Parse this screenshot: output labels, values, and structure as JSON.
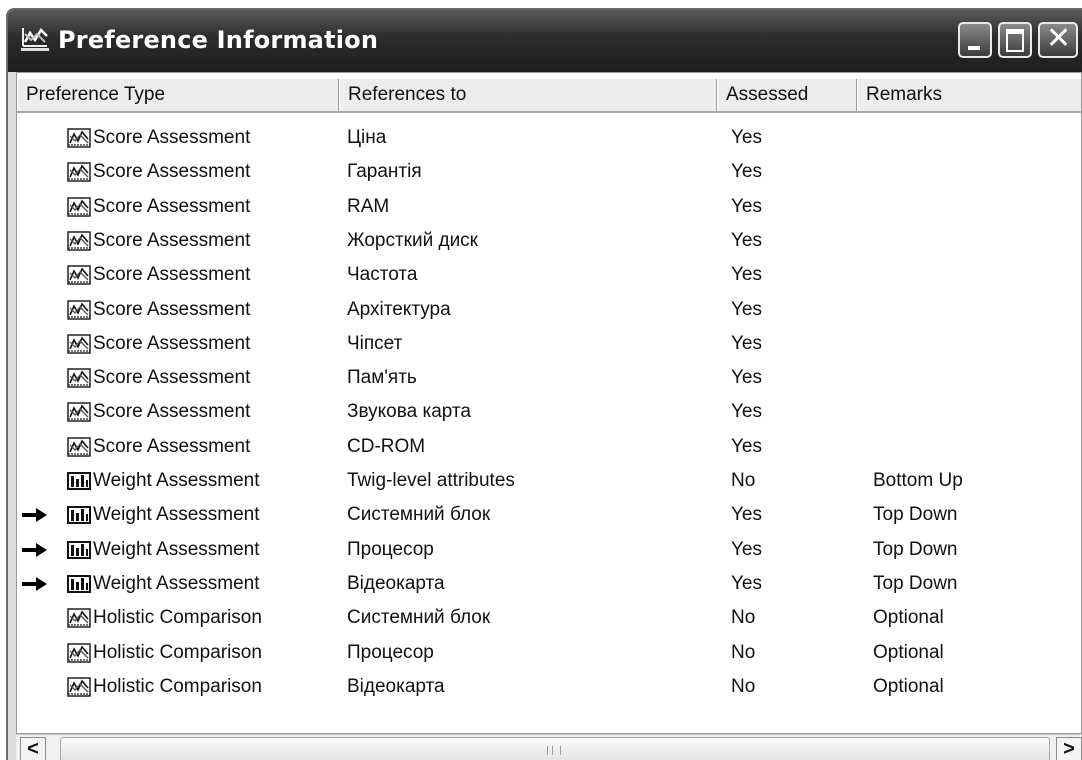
{
  "window": {
    "title": "Preference Information"
  },
  "titlebar_buttons": {
    "close_glyph": "✕"
  },
  "columns": [
    "Preference Type",
    "References to",
    "Assessed",
    "Remarks"
  ],
  "rows": [
    {
      "icon": "score-chart-icon",
      "marked": false,
      "type": "Score Assessment",
      "ref": "Ціна",
      "assessed": "Yes",
      "remarks": ""
    },
    {
      "icon": "score-chart-icon",
      "marked": false,
      "type": "Score Assessment",
      "ref": "Гарантія",
      "assessed": "Yes",
      "remarks": ""
    },
    {
      "icon": "score-chart-icon",
      "marked": false,
      "type": "Score Assessment",
      "ref": "RAM",
      "assessed": "Yes",
      "remarks": ""
    },
    {
      "icon": "score-chart-icon",
      "marked": false,
      "type": "Score Assessment",
      "ref": "Жорсткий диск",
      "assessed": "Yes",
      "remarks": ""
    },
    {
      "icon": "score-chart-icon",
      "marked": false,
      "type": "Score Assessment",
      "ref": "Частота",
      "assessed": "Yes",
      "remarks": ""
    },
    {
      "icon": "score-chart-icon",
      "marked": false,
      "type": "Score Assessment",
      "ref": "Архітектура",
      "assessed": "Yes",
      "remarks": ""
    },
    {
      "icon": "score-chart-icon",
      "marked": false,
      "type": "Score Assessment",
      "ref": "Чіпсет",
      "assessed": "Yes",
      "remarks": ""
    },
    {
      "icon": "score-chart-icon",
      "marked": false,
      "type": "Score Assessment",
      "ref": "Пам'ять",
      "assessed": "Yes",
      "remarks": ""
    },
    {
      "icon": "score-chart-icon",
      "marked": false,
      "type": "Score Assessment",
      "ref": "Звукова карта",
      "assessed": "Yes",
      "remarks": ""
    },
    {
      "icon": "score-chart-icon",
      "marked": false,
      "type": "Score Assessment",
      "ref": "CD-ROM",
      "assessed": "Yes",
      "remarks": ""
    },
    {
      "icon": "weight-bars-icon",
      "marked": false,
      "type": "Weight Assessment",
      "ref": "Twig-level attributes",
      "assessed": "No",
      "remarks": "Bottom Up"
    },
    {
      "icon": "weight-bars-icon",
      "marked": true,
      "type": "Weight Assessment",
      "ref": "Системний блок",
      "assessed": "Yes",
      "remarks": "Top Down"
    },
    {
      "icon": "weight-bars-icon",
      "marked": true,
      "type": "Weight Assessment",
      "ref": "Процесор",
      "assessed": "Yes",
      "remarks": "Top Down"
    },
    {
      "icon": "weight-bars-icon",
      "marked": true,
      "type": "Weight Assessment",
      "ref": "Відеокарта",
      "assessed": "Yes",
      "remarks": "Top Down"
    },
    {
      "icon": "score-chart-icon",
      "marked": false,
      "type": "Holistic Comparison",
      "ref": "Системний блок",
      "assessed": "No",
      "remarks": "Optional"
    },
    {
      "icon": "score-chart-icon",
      "marked": false,
      "type": "Holistic Comparison",
      "ref": "Процесор",
      "assessed": "No",
      "remarks": "Optional"
    },
    {
      "icon": "score-chart-icon",
      "marked": false,
      "type": "Holistic Comparison",
      "ref": "Відеокарта",
      "assessed": "No",
      "remarks": "Optional"
    }
  ],
  "scrollbar": {
    "left_glyph": "<",
    "right_glyph": ">"
  }
}
